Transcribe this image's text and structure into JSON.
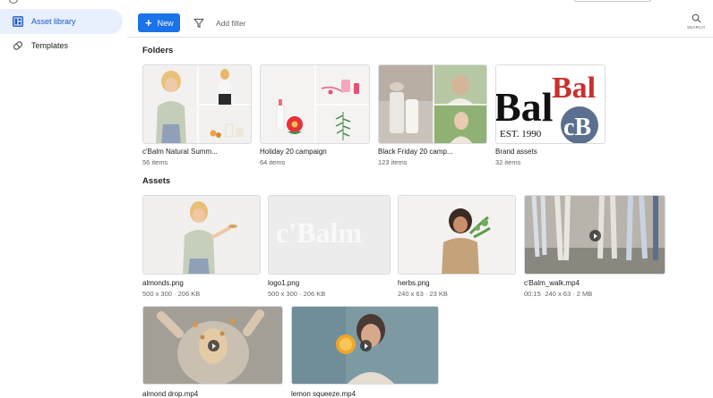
{
  "sidebar": {
    "items": [
      {
        "label": "Asset library",
        "icon": "library-icon",
        "active": true
      },
      {
        "label": "Templates",
        "icon": "templates-icon",
        "active": false
      }
    ]
  },
  "toolbar": {
    "new_label": "New",
    "add_filter_label": "Add filter",
    "search_label": "SEARCH"
  },
  "folders": {
    "title": "Folders",
    "items": [
      {
        "name": "c'Balm Natural Summ...",
        "count": "56 items"
      },
      {
        "name": "Holiday 20 campaign",
        "count": "64 items"
      },
      {
        "name": "Black Friday 20 camp...",
        "count": "123 items"
      },
      {
        "name": "Brand assets",
        "count": "32 items"
      }
    ],
    "brand_logo": {
      "bal": "Bal",
      "est": "EST. 1990",
      "bal_red": "Bal",
      "cb": "cB"
    }
  },
  "assets": {
    "title": "Assets",
    "items": [
      {
        "name": "almonds.png",
        "meta": "500 x 300 · 206 KB"
      },
      {
        "name": "logo1.png",
        "meta": "500 x 300 · 206 KB",
        "logo_text": "c'Balm"
      },
      {
        "name": "herbs.png",
        "meta": "240 x 63 · 23 KB"
      },
      {
        "name": "c'Balm_walk.mp4",
        "meta": "00:15 ·240 x 63 · 2 MB"
      },
      {
        "name": "almond drop.mp4",
        "meta": ""
      },
      {
        "name": "lemon squeeze.mp4",
        "meta": ""
      }
    ]
  },
  "colors": {
    "accent": "#1a73e8",
    "active_nav_bg": "#e8f0fe",
    "brand_red": "#c9302c",
    "brand_blue": "#5b6f8e"
  }
}
